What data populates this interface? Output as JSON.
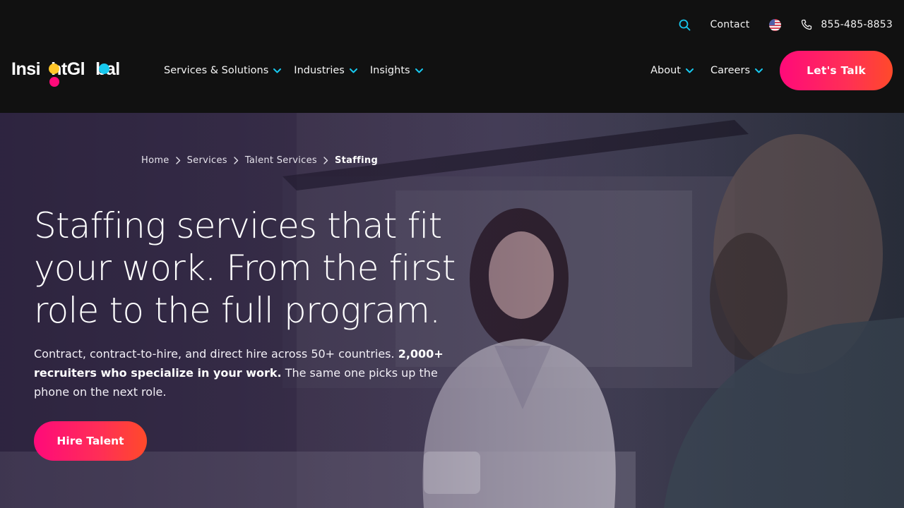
{
  "utility": {
    "contact_label": "Contact",
    "phone_number": "855-485-8853",
    "region_flag": "us-flag-icon"
  },
  "logo": {
    "text_prefix": "Insi",
    "text_mid": "ht",
    "text_g": "Gl",
    "text_suffix": "bal",
    "brand_colors": {
      "yellow": "#ffc629",
      "pink": "#ff0a7a",
      "blue": "#17c8ee"
    }
  },
  "nav": {
    "left": [
      {
        "label": "Services & Solutions"
      },
      {
        "label": "Industries"
      },
      {
        "label": "Insights"
      }
    ],
    "right": [
      {
        "label": "About"
      },
      {
        "label": "Careers"
      }
    ],
    "cta_label": "Let's Talk",
    "chevron_color": "#17c8ee"
  },
  "breadcrumb": {
    "items": [
      "Home",
      "Services",
      "Talent Services"
    ],
    "current": "Staffing"
  },
  "hero": {
    "headline": "Staffing services that fit your work. From the first role to the full program.",
    "lede_part1": "Contract, contract-to-hire, and direct hire across 50+ countries.",
    "lede_bold": "2,000+ recruiters who specialize in your work.",
    "lede_part2": "The same one picks up the phone on the next role.",
    "button_label": "Hire Talent"
  },
  "colors": {
    "header_bg": "#111111",
    "accent_gradient_start": "#ff0a7a",
    "accent_gradient_end": "#ff4a2a"
  }
}
